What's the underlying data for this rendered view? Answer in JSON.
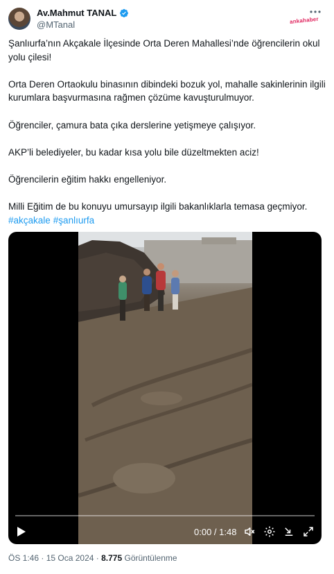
{
  "author": {
    "display_name": "Av.Mahmut TANAL",
    "handle": "@MTanal",
    "watermark": "ankahaber"
  },
  "tweet": {
    "paragraphs": [
      "Şanlıurfa’nın Akçakale İlçesinde Orta Deren Mahallesi’nde öğrencilerin okul yolu çilesi!",
      "Orta Deren Ortaokulu binasının dibindeki bozuk yol, mahalle sakinlerinin ilgili kurumlara başvurmasına rağmen çözüme kavuşturulmuyor.",
      "Öğrenciler, çamura bata çıka derslerine yetişmeye çalışıyor.",
      "AKP’li belediyeler, bu kadar kısa yolu bile düzeltmekten aciz!",
      "Öğrencilerin eğitim hakkı engelleniyor.",
      "Milli Eğitim de bu konuyu umursayıp ilgili bakanlıklarla temasa geçmiyor."
    ],
    "hashtags": [
      "#akçakale",
      "#şanlıurfa"
    ]
  },
  "video": {
    "time": "0:00 / 1:48",
    "progress": 0
  },
  "meta": {
    "time": "ÖS 1:46",
    "separator": "·",
    "date": "15 Oca 2024",
    "views_count": "8.775",
    "views_label": "Görüntülenme"
  },
  "colors": {
    "accent": "#1d9bf0",
    "text": "#0f1419",
    "secondary": "#536471"
  },
  "icons": [
    "verified-icon",
    "more-icon",
    "play-icon",
    "volume-icon",
    "settings-icon",
    "fullscreen-icon"
  ]
}
